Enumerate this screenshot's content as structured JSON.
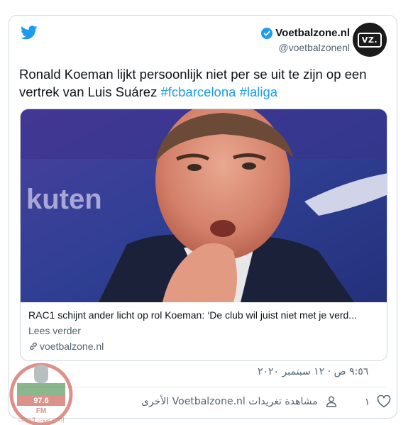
{
  "tweet": {
    "author": {
      "display_name": "Voetbalzone.nl",
      "handle": "@voetbalzonenl",
      "verified": true,
      "avatar_text": "VZ."
    },
    "text_prefix": "Ronald Koeman lijkt persoonlijk niet per se uit te zijn op een vertrek van Luis Suárez ",
    "hashtags": [
      "#fcbarcelona",
      "#laliga"
    ],
    "link_card": {
      "title": "RAC1 schijnt ander licht op rol Koeman: ‘De club wil juist niet met je verd...",
      "description": "Lees verder",
      "domain": "voetbalzone.nl",
      "photo_brand_text": "kuten"
    },
    "timestamp": "٩:٥٦ ص · ١٢ سبتمبر ٢٠٢٠",
    "likes": "١",
    "more_tweets_label": "مشاهدة تغريدات Voetbalzone.nl الأخرى"
  },
  "watermark": {
    "freq": "97.6",
    "band": "FM",
    "caption": "إذاعة صوت الشباب"
  },
  "colors": {
    "link_blue": "#1d9bf0",
    "twitter_blue": "#1d9bf0",
    "muted_text": "#536471",
    "border": "#cfd9de"
  },
  "icons": [
    "twitter-bird-icon",
    "verified-badge-icon",
    "link-icon",
    "person-icon",
    "heart-icon"
  ]
}
